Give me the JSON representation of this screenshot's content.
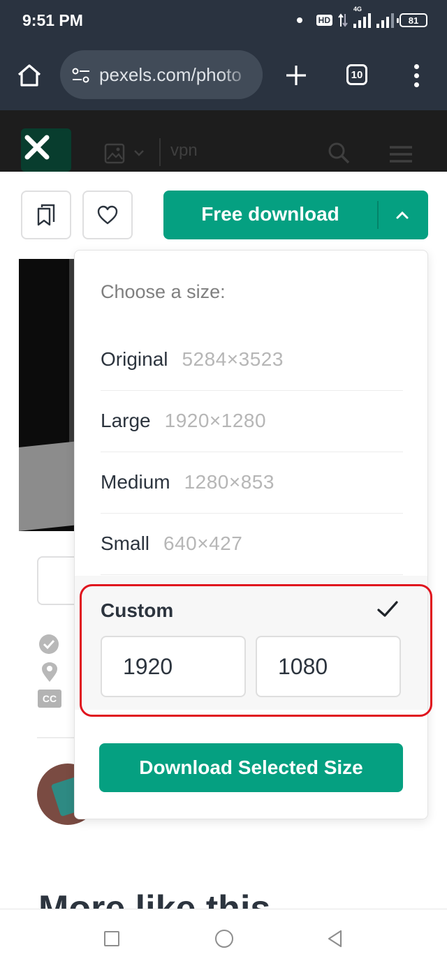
{
  "status_bar": {
    "time": "9:51 PM",
    "network_badge": "HD",
    "network_type": "4G",
    "battery": "81"
  },
  "browser": {
    "url": "pexels.com/photo",
    "tab_count": "10",
    "icons": [
      "home-icon",
      "site-settings-icon",
      "plus-icon",
      "tab-switcher-icon",
      "overflow-menu-icon"
    ]
  },
  "site_header": {
    "search_text": "vpn",
    "icons": [
      "close-icon",
      "image-icon",
      "chevron-down-icon",
      "search-icon",
      "hamburger-icon"
    ]
  },
  "actions": {
    "free_download_label": "Free download",
    "icons": [
      "bookmark-icon",
      "heart-icon",
      "caret-up-icon"
    ]
  },
  "size_menu": {
    "heading": "Choose a size:",
    "options": [
      {
        "name": "Original",
        "dimensions": "5284×3523"
      },
      {
        "name": "Large",
        "dimensions": "1920×1280"
      },
      {
        "name": "Medium",
        "dimensions": "1280×853"
      },
      {
        "name": "Small",
        "dimensions": "640×427"
      }
    ],
    "custom": {
      "label": "Custom",
      "width": "1920",
      "height": "1080",
      "selected": true
    },
    "download_button_label": "Download Selected Size"
  },
  "background": {
    "cc_label": "CC",
    "section_heading": "More like this"
  },
  "colors": {
    "accent": "#05a081",
    "highlight": "#e0141e",
    "topbar": "#2a3340"
  }
}
